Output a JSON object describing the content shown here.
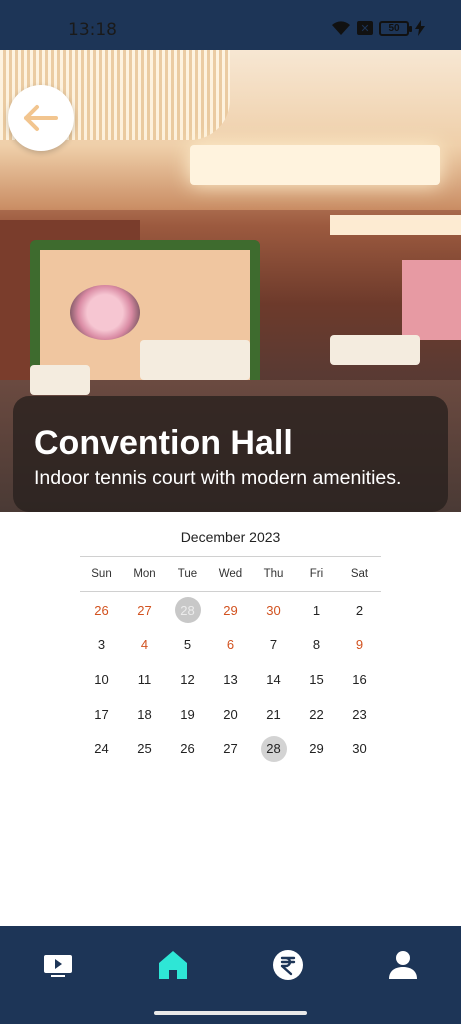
{
  "status_bar": {
    "time": "13:18",
    "battery": "50",
    "background": "#1d3557"
  },
  "hero": {
    "back_icon": "arrow-left-icon",
    "title": "Convention Hall",
    "description": "Indoor tennis court with modern amenities."
  },
  "calendar": {
    "month_label": "December 2023",
    "weekdays": [
      "Sun",
      "Mon",
      "Tue",
      "Wed",
      "Thu",
      "Fri",
      "Sat"
    ],
    "weeks": [
      [
        "26",
        "27",
        "28",
        "29",
        "30",
        "1",
        "2"
      ],
      [
        "3",
        "4",
        "5",
        "6",
        "7",
        "8",
        "9"
      ],
      [
        "10",
        "11",
        "12",
        "13",
        "14",
        "15",
        "16"
      ],
      [
        "17",
        "18",
        "19",
        "20",
        "21",
        "22",
        "23"
      ],
      [
        "24",
        "25",
        "26",
        "27",
        "28",
        "29",
        "30"
      ]
    ],
    "highlight_color": "#d2521f",
    "selected_color": "#d3d3d3"
  },
  "bottom_nav": {
    "items": [
      {
        "icon": "tv-icon",
        "active": false
      },
      {
        "icon": "home-icon",
        "active": true
      },
      {
        "icon": "rupee-icon",
        "active": false
      },
      {
        "icon": "user-icon",
        "active": false
      }
    ],
    "active_color": "#2ee6d6",
    "inactive_color": "#ffffff"
  }
}
